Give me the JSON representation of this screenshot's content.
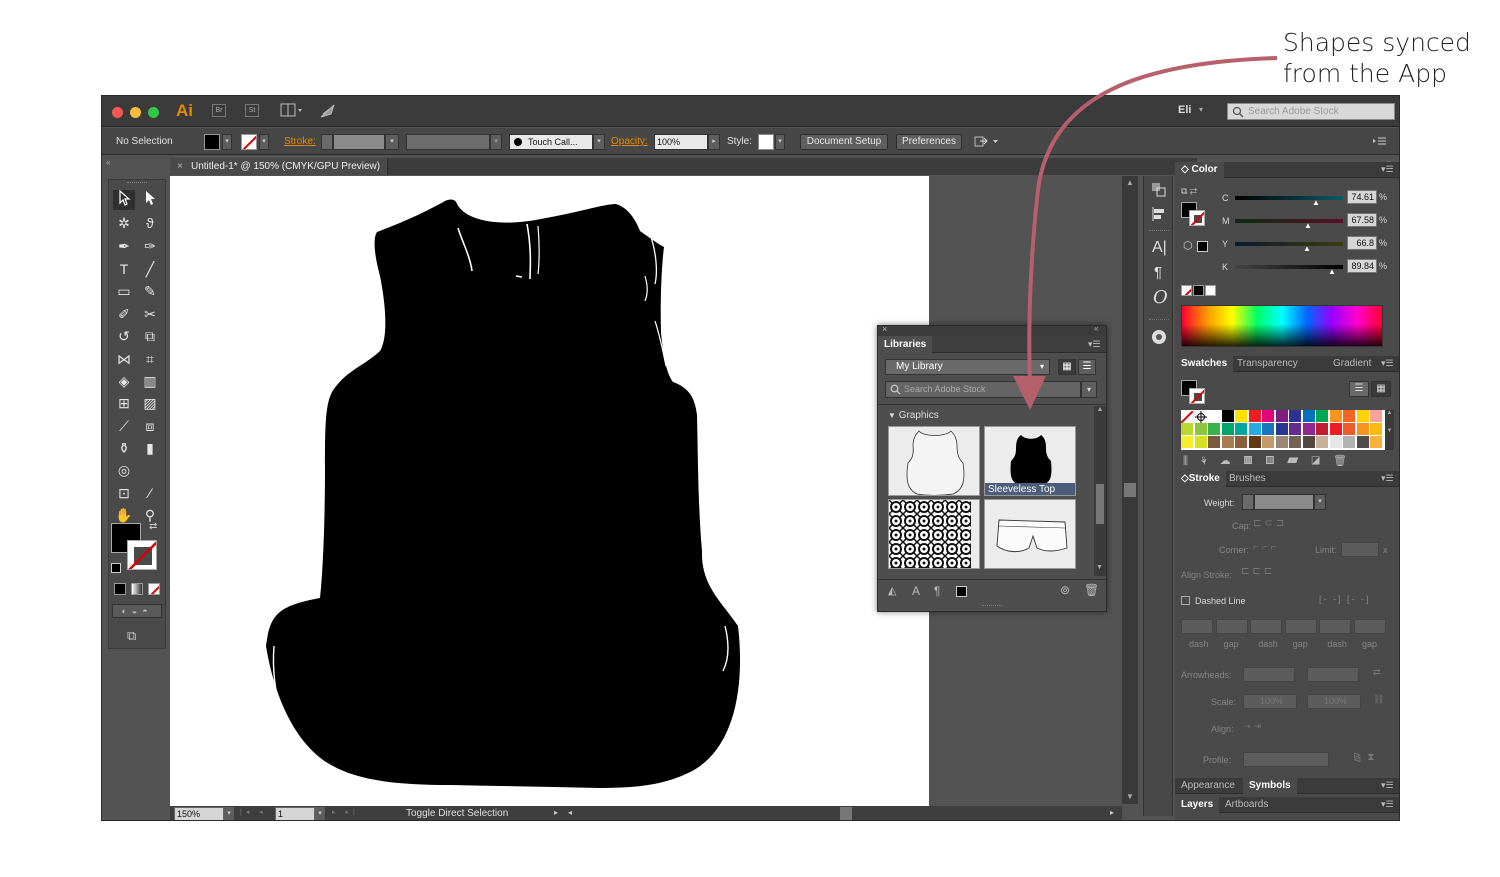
{
  "annotation": {
    "line1": "Shapes synced",
    "line2": "from the App"
  },
  "titlebar": {
    "app_logo": "Ai",
    "br_label": "Br",
    "st_label": "St",
    "user": "Eli",
    "user_caret": "▾",
    "stock_search_placeholder": "Search Adobe Stock"
  },
  "control_bar": {
    "selection": "No Selection",
    "stroke_label": "Stroke:",
    "brush": "Touch Call...",
    "opacity_label": "Opacity:",
    "opacity_value": "100%",
    "style_label": "Style:",
    "document_setup": "Document Setup",
    "preferences": "Preferences"
  },
  "document": {
    "tab_title": "Untitled-1* @ 150% (CMYK/GPU Preview)"
  },
  "status_bar": {
    "zoom": "150%",
    "artboard": "1",
    "tool_status": "Toggle Direct Selection"
  },
  "color_panel": {
    "title": "Color",
    "channels": [
      {
        "label": "C",
        "value": "74.61",
        "unit": "%"
      },
      {
        "label": "M",
        "value": "67.58",
        "unit": "%"
      },
      {
        "label": "Y",
        "value": "66.8",
        "unit": "%"
      },
      {
        "label": "K",
        "value": "89.84",
        "unit": "%"
      }
    ]
  },
  "swatches_panel": {
    "tabs": [
      "Swatches",
      "Transparency",
      "Gradient"
    ]
  },
  "stroke_panel": {
    "tabs": [
      "Stroke",
      "Brushes"
    ],
    "weight_label": "Weight:",
    "cap_label": "Cap:",
    "corner_label": "Corner:",
    "limit_label": "Limit:",
    "limit_unit": "x",
    "align_label": "Align Stroke:",
    "dashed_line": "Dashed Line",
    "dash_labels": [
      "dash",
      "gap",
      "dash",
      "gap",
      "dash",
      "gap"
    ],
    "arrowheads_label": "Arrowheads:",
    "scale_label": "Scale:",
    "scale_values": [
      "100%",
      "100%"
    ],
    "align2_label": "Align:",
    "profile_label": "Profile:"
  },
  "bottom_panels": {
    "row1": [
      "Appearance",
      "Symbols"
    ],
    "row2": [
      "Layers",
      "Artboards"
    ]
  },
  "libraries_panel": {
    "title": "Libraries",
    "library": "My Library",
    "search_placeholder": "Search Adobe Stock",
    "section": "Graphics",
    "selected_item": "Sleeveless Top"
  },
  "colors": {
    "accent_orange": "#e68a00",
    "arrow": "#b5606b"
  }
}
